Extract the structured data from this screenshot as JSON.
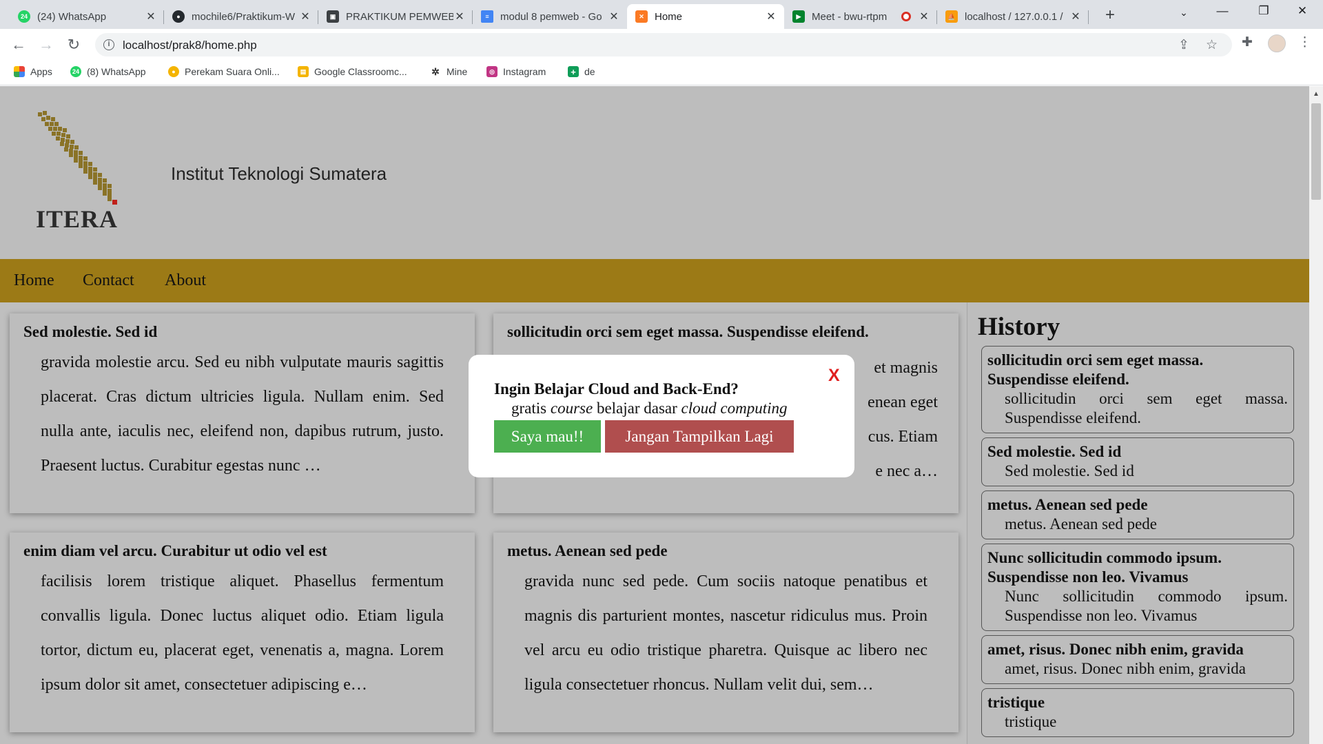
{
  "browser": {
    "tabs": [
      {
        "label": "(24) WhatsApp",
        "icon": "whatsapp-icon",
        "badge": "24",
        "color": "#25d366"
      },
      {
        "label": "mochile6/Praktikum-W",
        "icon": "github-icon",
        "color": "#24292e"
      },
      {
        "label": "PRAKTIKUM PEMWEB",
        "icon": "id-card-icon",
        "color": "#3c4043"
      },
      {
        "label": "modul 8 pemweb - Go",
        "icon": "google-docs-icon",
        "color": "#4285f4"
      },
      {
        "label": "Home",
        "icon": "xampp-icon",
        "color": "#fb7a24",
        "active": true
      },
      {
        "label": "Meet - bwu-rtpm",
        "icon": "google-meet-icon",
        "color": "#00832d",
        "recording": true
      },
      {
        "label": "localhost / 127.0.0.1 /",
        "icon": "phpmyadmin-icon",
        "color": "#f89c0e"
      }
    ],
    "url": "localhost/prak8/home.php",
    "bookmarks": [
      {
        "label": "Apps",
        "icon": "apps-grid-icon",
        "color": "#ea4335"
      },
      {
        "label": "(8) WhatsApp",
        "icon": "whatsapp-icon",
        "badge": "24",
        "color": "#25d366"
      },
      {
        "label": "Perekam Suara Onli...",
        "icon": "recorder-icon",
        "color": "#f4b400"
      },
      {
        "label": "Google Classroomc...",
        "icon": "classroom-icon",
        "color": "#f4b400"
      },
      {
        "label": "Mine",
        "icon": "mine-icon",
        "color": "#333333"
      },
      {
        "label": "Instagram",
        "icon": "instagram-icon",
        "color": "#c13584"
      },
      {
        "label": "de",
        "icon": "sheets-plus-icon",
        "color": "#0f9d58"
      }
    ]
  },
  "site": {
    "logo_text": "ITERA",
    "title": "Institut Teknologi Sumatera",
    "nav": [
      "Home",
      "Contact",
      "About"
    ],
    "accent": "#9c7a16"
  },
  "articles": [
    {
      "title": "Sed molestie. Sed id",
      "body": "gravida molestie arcu. Sed eu nibh vulputate mauris sagittis placerat. Cras dictum ultricies ligula. Nullam enim. Sed nulla ante, iaculis nec, eleifend non, dapibus rutrum, justo. Praesent luctus. Curabitur egestas nunc …"
    },
    {
      "title": "sollicitudin orci sem eget massa. Suspendisse eleifend.",
      "body": "et magnis … enean eget … cus. Etiam … e nec a…",
      "visible_fragments": [
        "et magnis",
        "enean eget",
        "cus. Etiam",
        "e nec a…"
      ]
    },
    {
      "title": "enim diam vel arcu. Curabitur ut odio vel est",
      "body": "facilisis lorem tristique aliquet. Phasellus fermentum convallis ligula. Donec luctus aliquet odio. Etiam ligula tortor, dictum eu, placerat eget, venenatis a, magna. Lorem ipsum dolor sit amet, consectetuer adipiscing e…"
    },
    {
      "title": "metus. Aenean sed pede",
      "body": "gravida nunc sed pede. Cum sociis natoque penatibus et magnis dis parturient montes, nascetur ridiculus mus. Proin vel arcu eu odio tristique pharetra. Quisque ac libero nec ligula consectetuer rhoncus. Nullam velit dui, sem…"
    }
  ],
  "history": {
    "title": "History",
    "items": [
      {
        "title": "sollicitudin orci sem eget massa. Suspendisse eleifend.",
        "desc": "sollicitudin orci sem eget massa. Suspendisse eleifend."
      },
      {
        "title": "Sed molestie. Sed id",
        "desc": "Sed molestie. Sed id"
      },
      {
        "title": "metus. Aenean sed pede",
        "desc": "metus. Aenean sed pede"
      },
      {
        "title": "Nunc sollicitudin commodo ipsum. Suspendisse non leo. Vivamus",
        "desc": "Nunc sollicitudin commodo ipsum. Suspendisse non leo. Vivamus"
      },
      {
        "title": "amet, risus. Donec nibh enim, gravida",
        "desc": "amet, risus. Donec nibh enim, gravida"
      },
      {
        "title": "tristique",
        "desc": "tristique"
      }
    ]
  },
  "modal": {
    "close_label": "X",
    "heading": "Ingin Belajar Cloud and Back-End?",
    "sub_parts": [
      "gratis ",
      "course",
      " belajar dasar ",
      "cloud computing"
    ],
    "yes_label": "Saya mau!!",
    "no_label": "Jangan Tampilkan Lagi",
    "yes_color": "#4caf50",
    "no_color": "#b04e4e",
    "close_color": "#e02020"
  }
}
